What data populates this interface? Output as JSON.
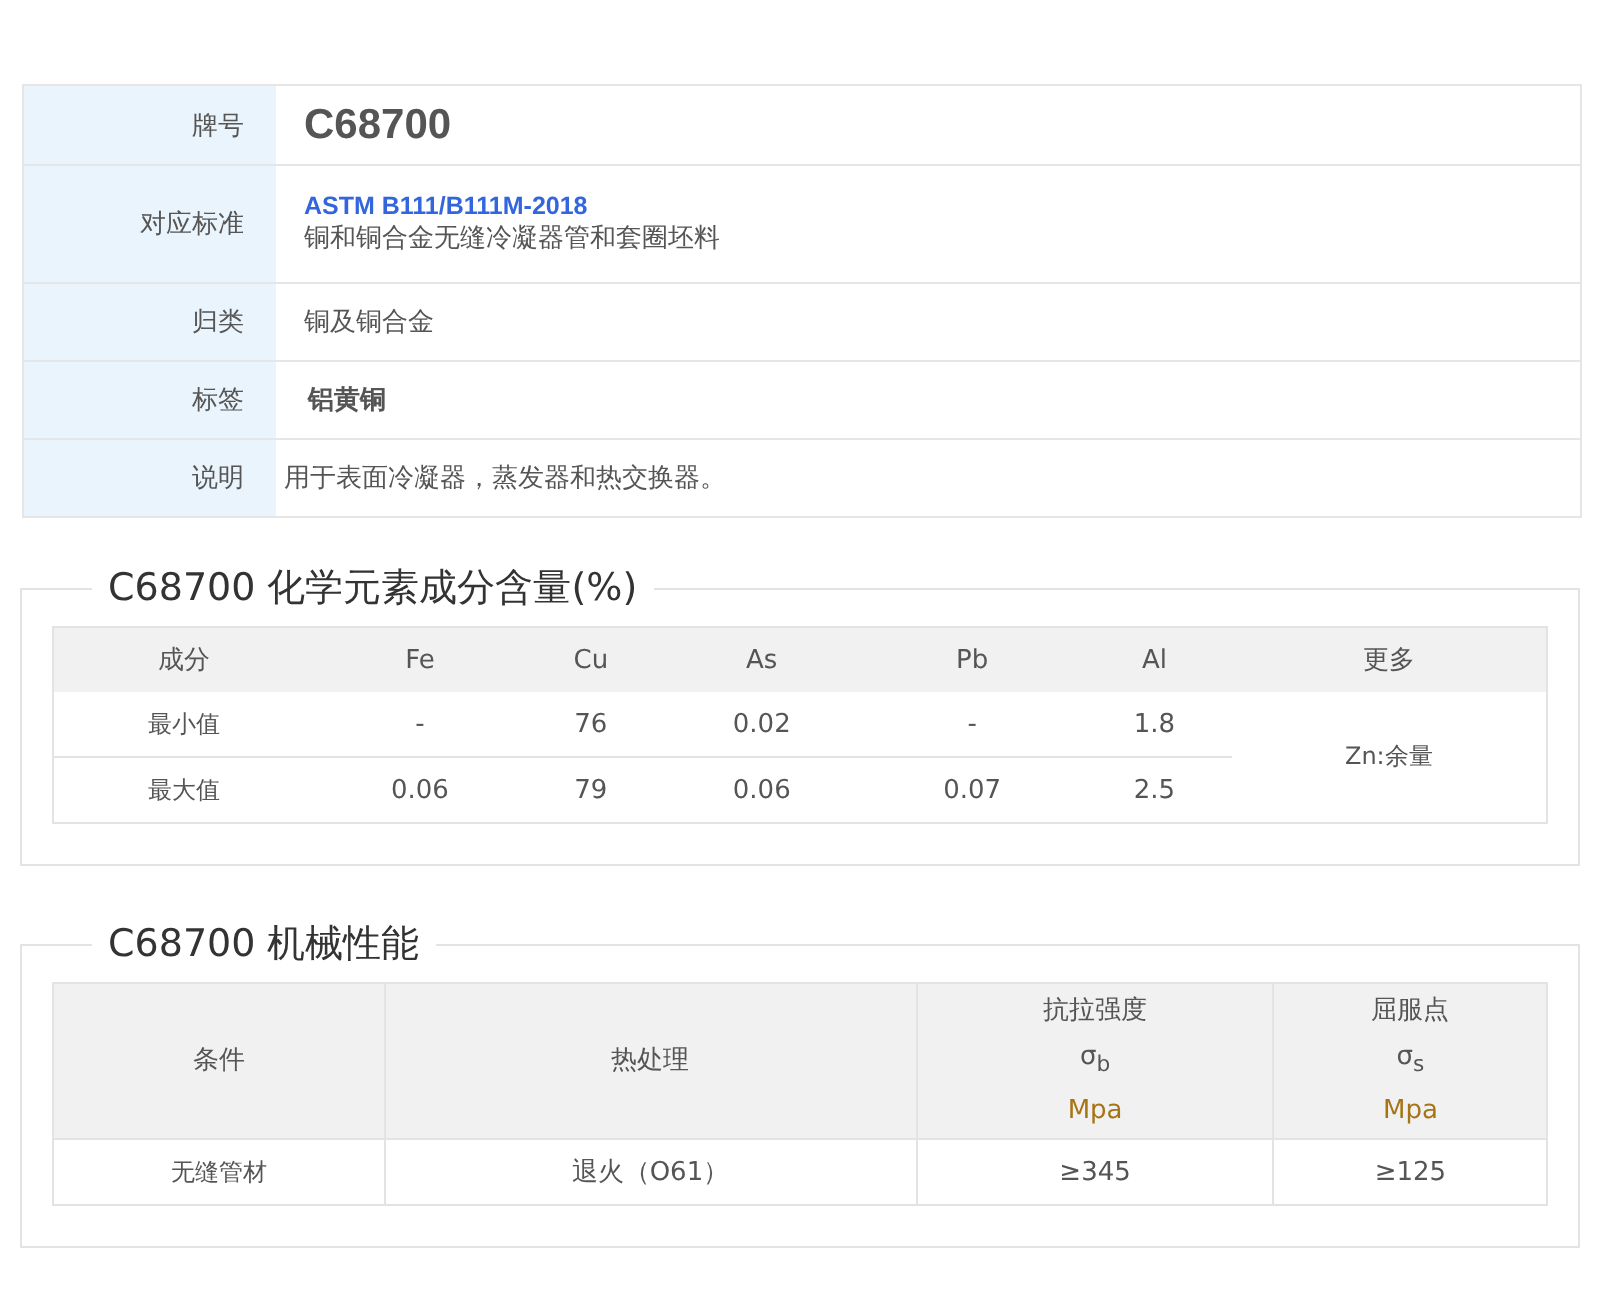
{
  "info": [
    {
      "kind": "grade",
      "label": "牌号",
      "value": "C68700"
    },
    {
      "kind": "standard",
      "label": "对应标准",
      "link": "ASTM B111/B111M-2018",
      "value": "铜和铜合金无缝冷凝器管和套圈坯料"
    },
    {
      "kind": "text",
      "label": "归类",
      "value": "铜及铜合金"
    },
    {
      "kind": "tag",
      "label": "标签",
      "value": "铝黄铜"
    },
    {
      "kind": "note",
      "label": "说明",
      "value": "用于表面冷凝器，蒸发器和热交换器。"
    }
  ],
  "composition": {
    "title": "C68700 化学元素成分含量(%)",
    "columns": [
      "成分",
      "Fe",
      "Cu",
      "As",
      "Pb",
      "Al",
      "更多"
    ],
    "rows": [
      {
        "label": "最小值",
        "values": [
          "-",
          "76",
          "0.02",
          "-",
          "1.8"
        ]
      },
      {
        "label": "最大值",
        "values": [
          "0.06",
          "79",
          "0.06",
          "0.07",
          "2.5"
        ]
      }
    ],
    "more": "Zn:余量"
  },
  "mechanical": {
    "title": "C68700 机械性能",
    "columns": [
      {
        "name": "条件"
      },
      {
        "name": "热处理"
      },
      {
        "name": "抗拉强度",
        "symbol": "σ$_{b}$",
        "unit": "Mpa"
      },
      {
        "name": "屈服点",
        "symbol": "σ$_{s}$",
        "unit": "Mpa"
      }
    ],
    "rows": [
      {
        "cells": [
          "无缝管材",
          "退火（O61）",
          "≥345",
          "≥125"
        ]
      }
    ]
  }
}
